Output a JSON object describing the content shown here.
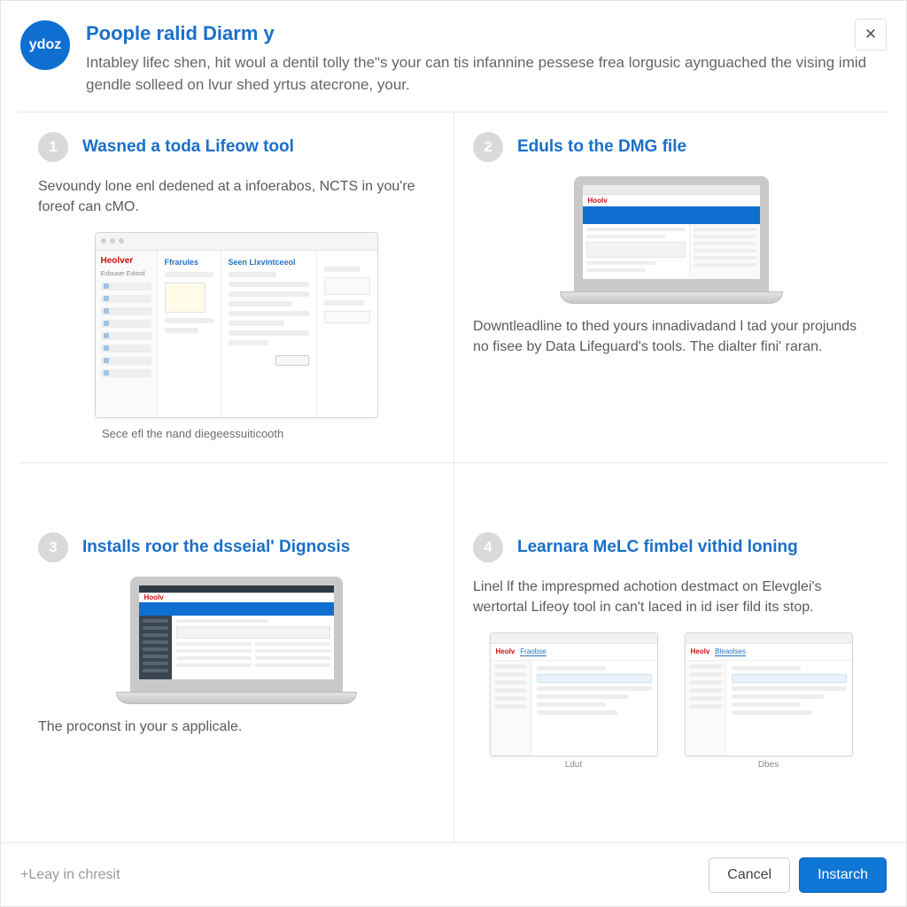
{
  "header": {
    "logo_text": "ydoz",
    "title": "Poople ralid Diarm y",
    "desc": "Intabley lifec shen, hit woul a dentil tolly the\"s your can tis infannine pessese frea lorgusic aynguached the vising imid gendle solleed on lvur shed yrtus atecrone, your."
  },
  "steps": [
    {
      "num": "1",
      "title": "Wasned a toda Lifeow tool",
      "desc": "Sevoundy lone enl dedened at a infoerabos, NCTS in you're foreof can cMO.",
      "caption": "Sece efl the nand diegeessuiticooth"
    },
    {
      "num": "2",
      "title": "Eduls to the DMG file",
      "desc": "Downtleadline to thed yours innadivadand l tad your projunds no fisee by Data Lifeguard's tools.  The dialter fini' raran."
    },
    {
      "num": "3",
      "title": "Installs roor the dsseial' Dignosis",
      "desc": "The proconst in your s applicale."
    },
    {
      "num": "4",
      "title": "Learnara MeLC fimbel vithid loning",
      "desc": "Linel lf the imprespmed achotion destmact on Elevglei's wertortal Lifeoy tool in can't laced in id iser fild its stop."
    }
  ],
  "illus": {
    "win1": {
      "brand": "Heolver",
      "section": "Ffrarules",
      "col_mid_head": "Seen Llxvintceeol"
    },
    "mini_caps": [
      "Ldut",
      "Dbes"
    ]
  },
  "footer": {
    "hint": "+Leay in chresit",
    "cancel": "Cancel",
    "install": "Instarch"
  }
}
